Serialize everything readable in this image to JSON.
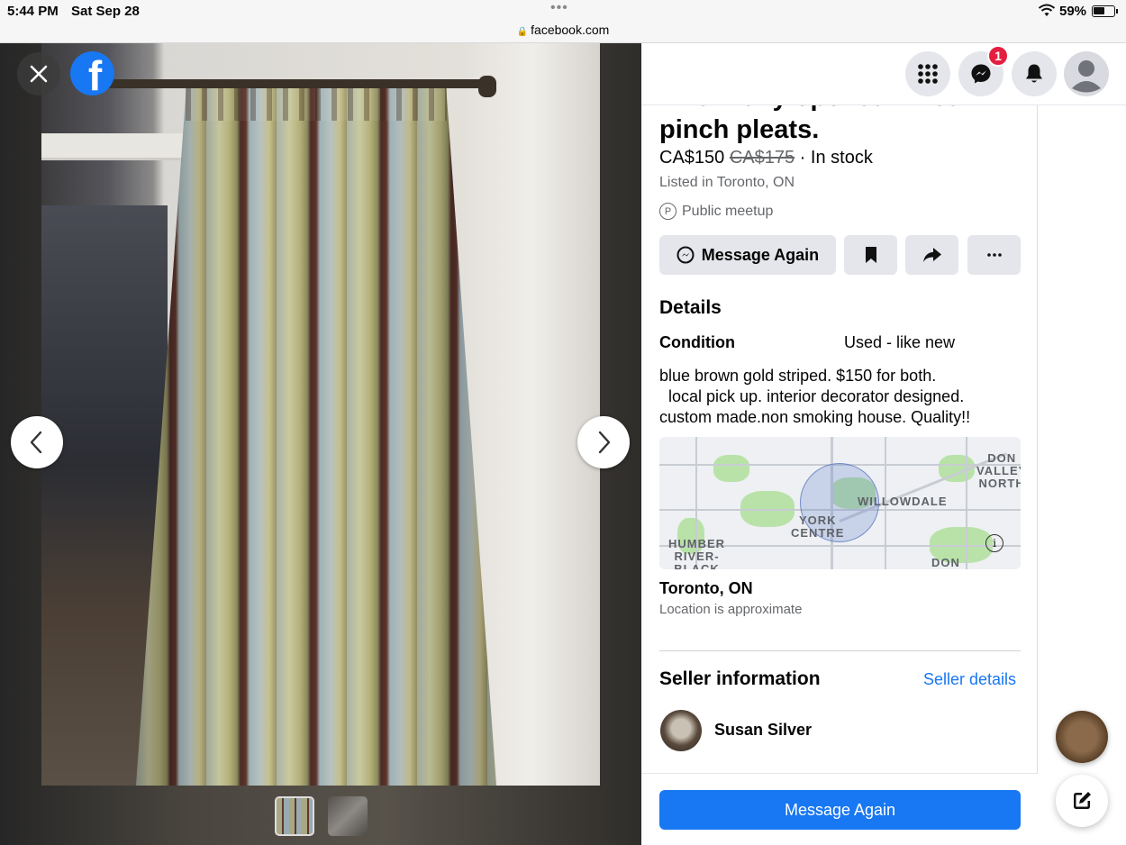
{
  "status_bar": {
    "time": "5:44 PM",
    "date": "Sat Sep 28",
    "url": "facebook.com",
    "battery_percent": "59%",
    "battery_level": 0.59
  },
  "viewer": {
    "close_icon": "close-icon",
    "logo_icon": "facebook-logo-icon",
    "logo_letter": "f",
    "prev_icon": "chevron-left-icon",
    "next_icon": "chevron-right-icon",
    "thumbnails_count": 2
  },
  "top_nav": {
    "menu_icon": "grid-menu-icon",
    "messenger_icon": "messenger-icon",
    "messenger_badge": "1",
    "notifications_icon": "bell-icon",
    "profile_icon": "avatar-icon"
  },
  "listing": {
    "title_partial_line": "when fully opened. lined.",
    "title_last_line": "pinch pleats.",
    "price": "CA$150",
    "old_price": "CA$175",
    "availability": " · In stock",
    "listed_in": "Listed in Toronto, ON",
    "meetup": "Public meetup",
    "meetup_icon_letter": "P"
  },
  "actions": {
    "message_again": "Message Again",
    "save_icon": "bookmark-icon",
    "share_icon": "share-icon",
    "more_icon": "more-horizontal-icon"
  },
  "details": {
    "heading": "Details",
    "condition_label": "Condition",
    "condition_value": "Used - like new",
    "description": "blue brown gold striped. $150 for both.\n  local pick up. interior decorator designed.\ncustom made.non smoking house. Quality!!"
  },
  "map": {
    "labels": {
      "don_valley_north": "DON\nVALLEY\nNORTH",
      "willowdale": "WILLOWDALE",
      "york_centre": "YORK\nCENTRE",
      "humber": "HUMBER\nRIVER-\nBLACK",
      "don": "DON"
    },
    "info_icon": "i"
  },
  "location": {
    "city": "Toronto, ON",
    "note": "Location is approximate"
  },
  "seller": {
    "heading": "Seller information",
    "details_link": "Seller details",
    "name": "Susan Silver"
  },
  "footer": {
    "message_again": "Message Again"
  },
  "colors": {
    "brand": "#1877f2",
    "badge": "#e41e3f",
    "button_gray": "#e4e6eb",
    "secondary_text": "#65676b"
  }
}
